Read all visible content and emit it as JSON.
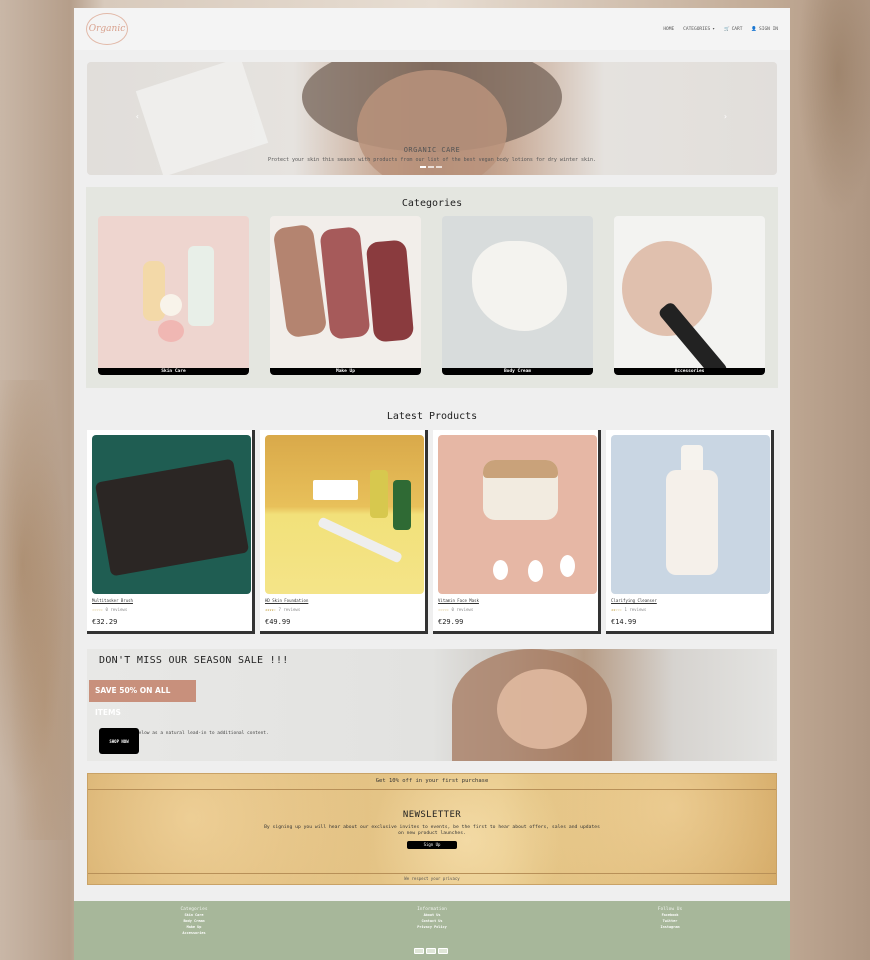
{
  "header": {
    "logo_text": "Organic",
    "nav": {
      "home": "HOME",
      "categories": "CATEGORIES",
      "cart": "CART",
      "signin": "SIGN IN"
    }
  },
  "hero": {
    "title": "ORGANIC CARE",
    "text": "Protect your skin this season with products from our list of the best vegan body lotions for dry winter skin."
  },
  "categories": {
    "title": "Categories",
    "items": [
      {
        "label": "Skin Care"
      },
      {
        "label": "Make Up"
      },
      {
        "label": "Body Cream"
      },
      {
        "label": "Accessories"
      }
    ]
  },
  "latest": {
    "title": "Latest Products",
    "products": [
      {
        "name": "Multitasker Brush",
        "stars": "☆☆☆☆☆",
        "reviews": "0 reviews",
        "price": "€32.29"
      },
      {
        "name": "HD Skin Foundation",
        "stars": "★★★★☆",
        "reviews": "7 reviews",
        "price": "€49.99"
      },
      {
        "name": "Vitamin Face Mask",
        "stars": "☆☆☆☆☆",
        "reviews": "0 reviews",
        "price": "€29.99"
      },
      {
        "name": "Clarifying Cleanser",
        "stars": "★★☆☆☆",
        "reviews": "1 reviews",
        "price": "€14.99"
      }
    ]
  },
  "sale": {
    "heading": "DON'T MISS OUR SEASON SALE !!!",
    "badge": "SAVE 50% ON ALL ITEMS",
    "text": "g text below as a natural lead-in to additional content.",
    "button": "SHOP NOW"
  },
  "newsletter": {
    "top": "Get 10% off in your first purchase",
    "title": "NEWSLETTER",
    "text": "By signing up you will hear about our exclusive invites to events, be the first to hear about offers, sales and updates on new product launches.",
    "button": "Sign Up",
    "privacy": "We respect your privacy"
  },
  "footer": {
    "categories": {
      "heading": "Categories",
      "items": [
        "Skin Care",
        "Body Cream",
        "Make Up",
        "Accessories"
      ]
    },
    "information": {
      "heading": "Information",
      "items": [
        "About Us",
        "Contact Us",
        "Privacy Policy"
      ]
    },
    "follow": {
      "heading": "Follow Us",
      "items": [
        "Facebook",
        "Twitter",
        "Instagram"
      ]
    }
  }
}
